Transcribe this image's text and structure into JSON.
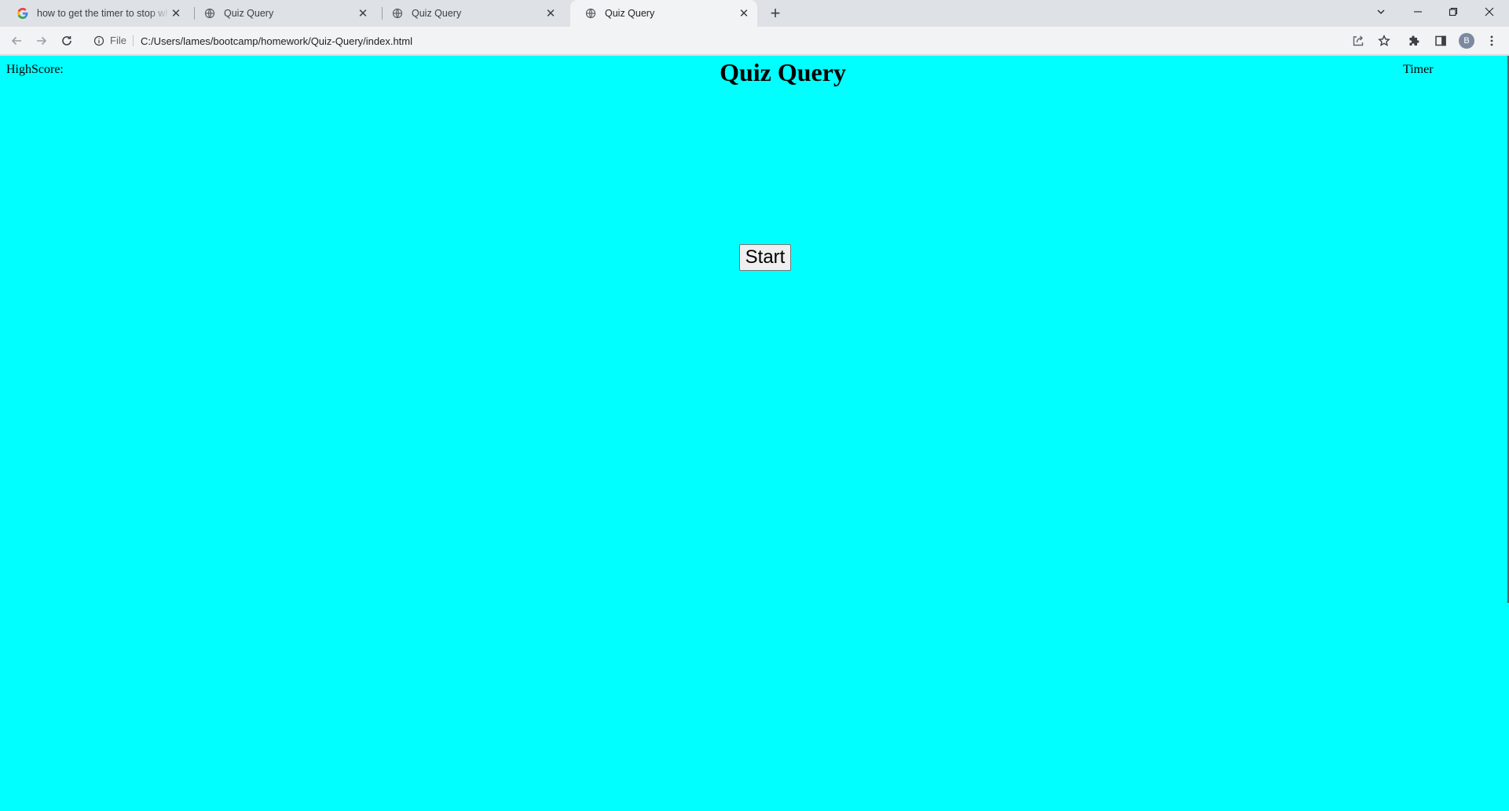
{
  "browser": {
    "tabs": [
      {
        "title": "how to get the timer to stop whe",
        "favicon": "google-g-icon",
        "active": false
      },
      {
        "title": "Quiz Query",
        "favicon": "globe-icon",
        "active": false
      },
      {
        "title": "Quiz Query",
        "favicon": "globe-icon",
        "active": false
      },
      {
        "title": "Quiz Query",
        "favicon": "globe-icon",
        "active": true
      }
    ],
    "close_glyph": "✕",
    "new_tab_glyph": "+",
    "address": {
      "scheme_label": "File",
      "url": "C:/Users/lames/bootcamp/homework/Quiz-Query/index.html"
    },
    "profile_initial": "B"
  },
  "page": {
    "background": "#00ffff",
    "highscore_label": "HighScore:",
    "title": "Quiz Query",
    "timer_label": "Timer",
    "start_button_label": "Start"
  }
}
